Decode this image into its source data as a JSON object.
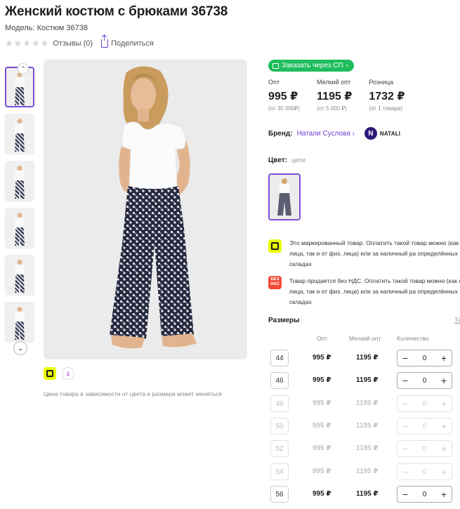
{
  "product": {
    "title": "Женский костюм с брюками 36738",
    "model": "Модель: Костюм 36738",
    "reviews": "Отзывы (0)",
    "share": "Поделиться",
    "rating": 0
  },
  "gallery": {
    "thumbnail_count": 6,
    "active_index": 0,
    "price_note": "Цена товара в зависимости от цвета и размера может меняться"
  },
  "sp_button": {
    "label": "Заказать через СП"
  },
  "prices": [
    {
      "label": "Опт",
      "value": "995 ₽",
      "min": "(от 35 000₽)"
    },
    {
      "label": "Мелкий опт",
      "value": "1195 ₽",
      "min": "(от 5 000 ₽)"
    },
    {
      "label": "Розница",
      "value": "1732 ₽",
      "min": "(от 1 товара)"
    }
  ],
  "brand": {
    "label": "Бренд:",
    "name": "Натали Суслова",
    "logo_letter": "N",
    "logo_text": "NATALI"
  },
  "color": {
    "label": "Цвет:",
    "value": "цепи"
  },
  "info": [
    {
      "icon": "marking-icon",
      "text": "Это маркированный товар. Оплатить такой товар можно (как от юр. лица, так и от физ. лица) или за наличный ра определённых складах"
    },
    {
      "icon": "no-vat-icon",
      "badge": "БЕЗ НАС",
      "text": "Товар продается без НДС. Оплатить такой товар можно (как от юр. лица, так и от физ. лица) или за наличный ра определённых складах"
    }
  ],
  "sizes": {
    "title": "Размеры",
    "link": "Та",
    "columns": {
      "opt": "Опт",
      "small": "Мелкий опт",
      "qty": "Количество"
    },
    "rows": [
      {
        "size": "44",
        "opt": "995 ₽",
        "small": "1195 ₽",
        "qty": "0",
        "available": true
      },
      {
        "size": "46",
        "opt": "995 ₽",
        "small": "1195 ₽",
        "qty": "0",
        "available": true
      },
      {
        "size": "48",
        "opt": "995 ₽",
        "small": "1195 ₽",
        "qty": "0",
        "available": false
      },
      {
        "size": "50",
        "opt": "995 ₽",
        "small": "1195 ₽",
        "qty": "0",
        "available": false
      },
      {
        "size": "52",
        "opt": "995 ₽",
        "small": "1195 ₽",
        "qty": "0",
        "available": false
      },
      {
        "size": "54",
        "opt": "995 ₽",
        "small": "1195 ₽",
        "qty": "0",
        "available": false
      },
      {
        "size": "56",
        "opt": "995 ₽",
        "small": "1195 ₽",
        "qty": "0",
        "available": true
      }
    ],
    "minus": "−",
    "plus": "+"
  },
  "colors": {
    "accent": "#6b3fd1",
    "green": "#1fbd5c",
    "marking": "#e9ff00",
    "nds": "#ef4b36"
  }
}
